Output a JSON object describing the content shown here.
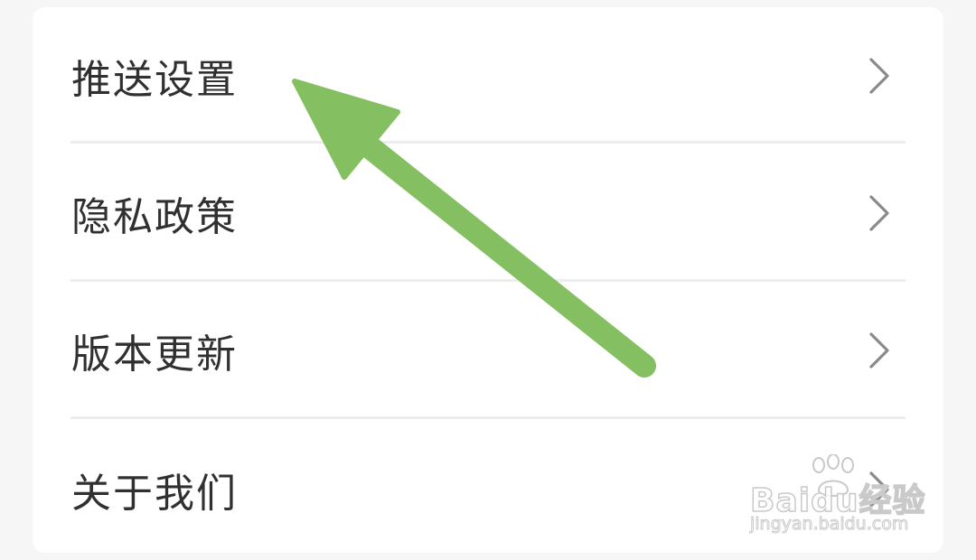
{
  "settings_menu": {
    "items": [
      {
        "label": "推送设置",
        "icon": "chevron-right-icon"
      },
      {
        "label": "隐私政策",
        "icon": "chevron-right-icon"
      },
      {
        "label": "版本更新",
        "icon": "chevron-right-icon"
      },
      {
        "label": "关于我们",
        "icon": "chevron-right-icon"
      }
    ]
  },
  "annotation": {
    "arrow_color": "#84c061",
    "arrow_icon": "arrow-up-left-icon"
  },
  "watermark": {
    "brand": "Baidu经验",
    "url": "jingyan.baidu.com"
  },
  "colors": {
    "background": "#f6f6f6",
    "card": "#ffffff",
    "text": "#303030",
    "divider": "#ededed",
    "chevron": "#8a8a8a"
  }
}
